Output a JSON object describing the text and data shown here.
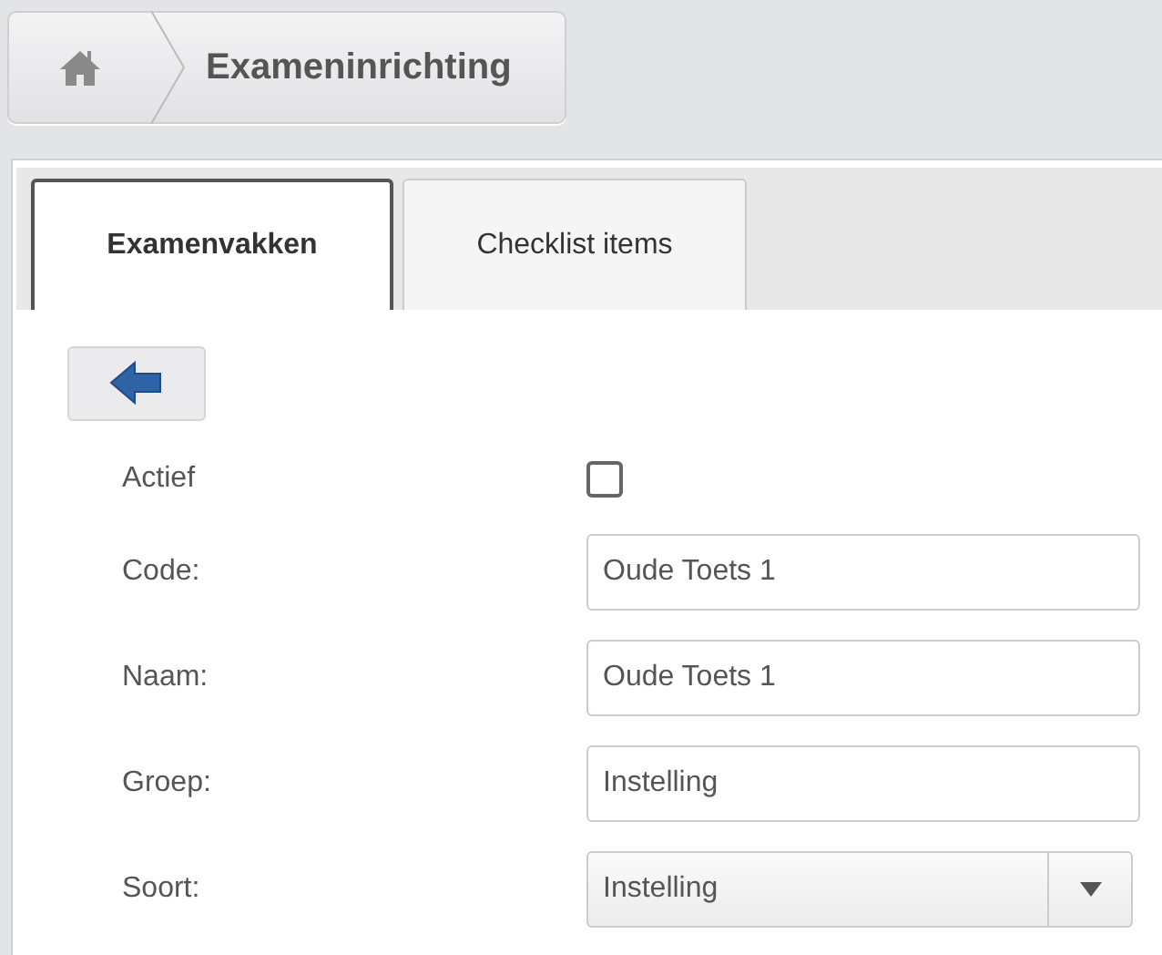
{
  "breadcrumb": {
    "title": "Exameninrichting"
  },
  "tabs": [
    {
      "label": "Examenvakken",
      "selected": true
    },
    {
      "label": "Checklist items",
      "selected": false
    }
  ],
  "fields": [
    {
      "kind": "checkbox",
      "label": "Actief",
      "checked": false
    },
    {
      "kind": "text",
      "label": "Code:",
      "value": "Oude Toets 1"
    },
    {
      "kind": "text",
      "label": "Naam:",
      "value": "Oude Toets 1"
    },
    {
      "kind": "text",
      "label": "Groep:",
      "value": "Instelling"
    },
    {
      "kind": "select",
      "label": "Soort:",
      "value": "Instelling"
    }
  ]
}
